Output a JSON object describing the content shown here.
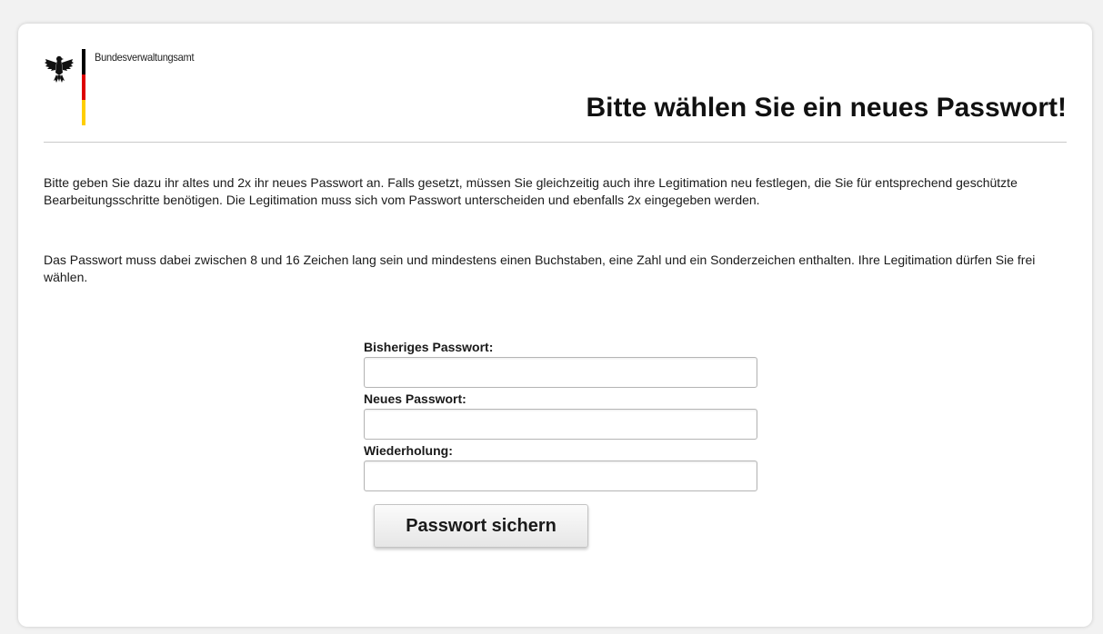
{
  "header": {
    "org_name": "Bundesverwaltungsamt",
    "page_title": "Bitte wählen Sie ein neues Passwort!",
    "logo_icon": "federal-eagle-icon",
    "flag_colors": [
      "#000000",
      "#dd0000",
      "#ffce00"
    ]
  },
  "intro": {
    "paragraph_1": "Bitte geben Sie dazu ihr altes und 2x ihr neues Passwort an. Falls gesetzt, müssen Sie gleichzeitig auch ihre Legitimation neu festlegen, die Sie für entsprechend geschützte Bearbeitungsschritte benötigen. Die Legitimation muss sich vom Passwort unterscheiden und ebenfalls 2x eingegeben werden.",
    "paragraph_2": "Das Passwort muss dabei zwischen 8 und 16 Zeichen lang sein und mindestens einen Buchstaben, eine Zahl und ein Sonderzeichen enthalten. Ihre Legitimation dürfen Sie frei wählen."
  },
  "form": {
    "old_password_label": "Bisheriges Passwort:",
    "old_password_value": "",
    "new_password_label": "Neues Passwort:",
    "new_password_value": "",
    "repeat_label": "Wiederholung:",
    "repeat_value": "",
    "save_label": "Passwort sichern"
  }
}
